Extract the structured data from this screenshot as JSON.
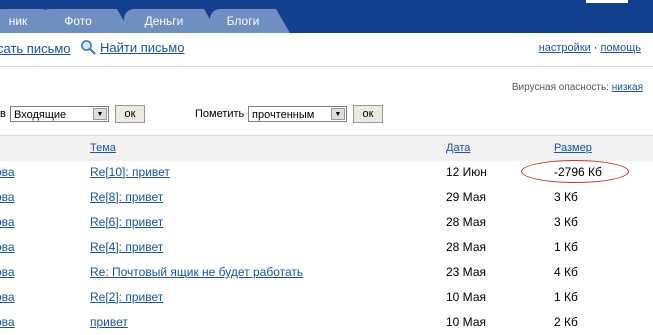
{
  "tabs": [
    {
      "label": "ник"
    },
    {
      "label": "Фото"
    },
    {
      "label": "Деньги"
    },
    {
      "label": "Блоги"
    }
  ],
  "actions": {
    "compose": "сать письмо",
    "find": "Найти письмо",
    "settings": "настройки",
    "separator": "·",
    "help": "помощь"
  },
  "virus": {
    "label": "Вирусная опасность:",
    "level": "низкая"
  },
  "filter": {
    "pre_label": "в",
    "folder_value": "Входящие",
    "ok1": "ок",
    "mark_label": "Пометить",
    "mark_value": "прочтенным",
    "ok2": "ок"
  },
  "table": {
    "headers": {
      "subject": "Тема",
      "date": "Дата",
      "size": "Размер"
    },
    "rows": [
      {
        "from": "ова",
        "subject": "Re[10]: привет",
        "date": "12 Июн",
        "size": "-2796 Кб"
      },
      {
        "from": "ова",
        "subject": "Re[8]: привет",
        "date": "29 Мая",
        "size": "3 Кб"
      },
      {
        "from": "ова",
        "subject": "Re[6]: привет",
        "date": "28 Мая",
        "size": "3 Кб"
      },
      {
        "from": "ова",
        "subject": "Re[4]: привет",
        "date": "28 Мая",
        "size": "1 Кб"
      },
      {
        "from": "ова",
        "subject": "Re: Почтовый ящик не будет работать",
        "date": "23 Мая",
        "size": "4 Кб"
      },
      {
        "from": "ова",
        "subject": "Re[2]: привет",
        "date": "10 Мая",
        "size": "1 Кб"
      },
      {
        "from": "ова",
        "subject": "привет",
        "date": "10 Мая",
        "size": "2 Кб"
      }
    ]
  },
  "colors": {
    "header_blue": "#123f8e",
    "tab_blue": "#6e8fbf",
    "link": "#1a52a8",
    "highlight_ellipse": "#c0342e"
  }
}
